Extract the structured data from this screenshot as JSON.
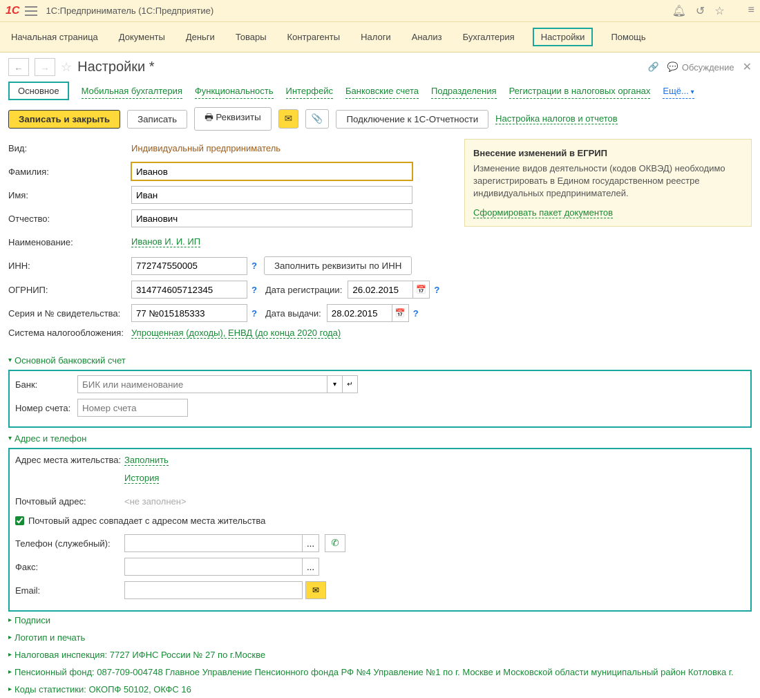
{
  "titlebar": {
    "app": "1С:Предприниматель  (1С:Предприятие)"
  },
  "mainmenu": [
    "Начальная страница",
    "Документы",
    "Деньги",
    "Товары",
    "Контрагенты",
    "Налоги",
    "Анализ",
    "Бухгалтерия",
    "Настройки",
    "Помощь"
  ],
  "page": {
    "title": "Настройки *",
    "discuss": "Обсуждение"
  },
  "tabs": [
    "Основное",
    "Мобильная бухгалтерия",
    "Функциональность",
    "Интерфейс",
    "Банковские счета",
    "Подразделения",
    "Регистрации в налоговых органах",
    "Ещё..."
  ],
  "toolbar": {
    "save_close": "Записать и закрыть",
    "save": "Записать",
    "requisites": "Реквизиты",
    "connect": "Подключение к 1С-Отчетности",
    "tax_link": "Настройка налогов и отчетов"
  },
  "form": {
    "vid_label": "Вид:",
    "vid_value": "Индивидуальный предприниматель",
    "surname_label": "Фамилия:",
    "surname": "Иванов",
    "name_label": "Имя:",
    "name": "Иван",
    "patronymic_label": "Отчество:",
    "patronymic": "Иванович",
    "title_label": "Наименование:",
    "title_value": "Иванов И. И. ИП",
    "inn_label": "ИНН:",
    "inn": "772747550005",
    "fill_by_inn": "Заполнить реквизиты по ИНН",
    "ogrnip_label": "ОГРНИП:",
    "ogrnip": "314774605712345",
    "reg_date_label": "Дата регистрации:",
    "reg_date": "26.02.2015",
    "cert_label": "Серия и № свидетельства:",
    "cert": "77 №015185333",
    "issue_date_label": "Дата выдачи:",
    "issue_date": "28.02.2015",
    "tax_system_label": "Система налогообложения:",
    "tax_system": "Упрощенная (доходы), ЕНВД (до конца 2020 года)"
  },
  "info": {
    "title": "Внесение изменений в ЕГРИП",
    "text": "Изменение видов деятельности (кодов ОКВЭД) необходимо зарегистрировать в Едином государственном реестре индивидуальных предпринимателей.",
    "link": "Сформировать пакет документов"
  },
  "bank": {
    "header": "Основной банковский счет",
    "bank_label": "Банк:",
    "bank_placeholder": "БИК или наименование",
    "acct_label": "Номер счета:",
    "acct_placeholder": "Номер счета"
  },
  "address": {
    "header": "Адрес и телефон",
    "addr_label": "Адрес места жительства:",
    "fill": "Заполнить",
    "history": "История",
    "post_label": "Почтовый адрес:",
    "not_filled": "<не заполнен>",
    "same_check": "Почтовый адрес совпадает с адресом места жительства",
    "phone_label": "Телефон (служебный):",
    "fax_label": "Факс:",
    "email_label": "Email:"
  },
  "collapsed": {
    "signatures": "Подписи",
    "logo": "Логотип и печать",
    "tax_insp": "Налоговая инспекция: 7727 ИФНС России № 27 по г.Москве",
    "pension": "Пенсионный фонд: 087-709-004748 Главное Управление Пенсионного фонда РФ №4 Управление №1 по г. Москве и Московской области муниципальный район Котловка г.",
    "stats": "Коды статистики: ОКОПФ 50102, ОКФС 16"
  }
}
